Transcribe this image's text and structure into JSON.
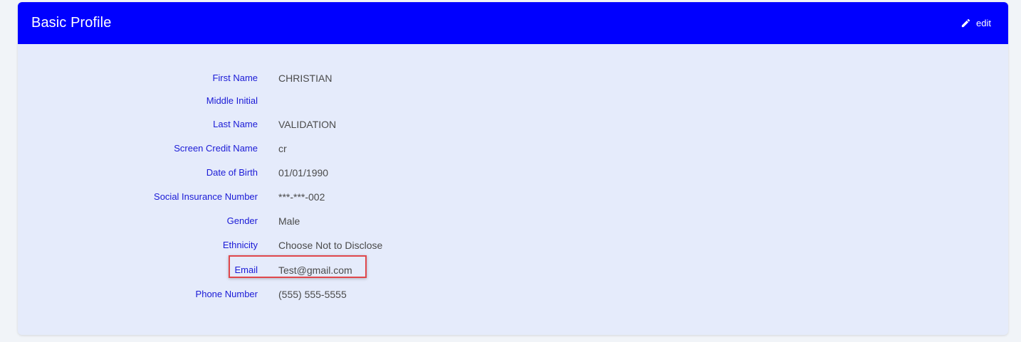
{
  "header": {
    "title": "Basic Profile",
    "edit_label": "edit",
    "edit_icon": "pencil-icon"
  },
  "fields": [
    {
      "label": "First Name",
      "value": "CHRISTIAN"
    },
    {
      "label": "Middle Initial",
      "value": ""
    },
    {
      "label": "Last Name",
      "value": "VALIDATION"
    },
    {
      "label": "Screen Credit Name",
      "value": "cr"
    },
    {
      "label": "Date of Birth",
      "value": "01/01/1990"
    },
    {
      "label": "Social Insurance Number",
      "value": "***-***-002"
    },
    {
      "label": "Gender",
      "value": "Male"
    },
    {
      "label": "Ethnicity",
      "value": "Choose Not to Disclose"
    },
    {
      "label": "Email",
      "value": "Test@gmail.com"
    },
    {
      "label": "Phone Number",
      "value": "(555) 555-5555"
    }
  ],
  "colors": {
    "header_bg": "#0000ff",
    "card_bg": "#e5ebfb",
    "label": "#1a1ad6",
    "value": "#4a4a4a",
    "highlight": "#e0474c"
  }
}
